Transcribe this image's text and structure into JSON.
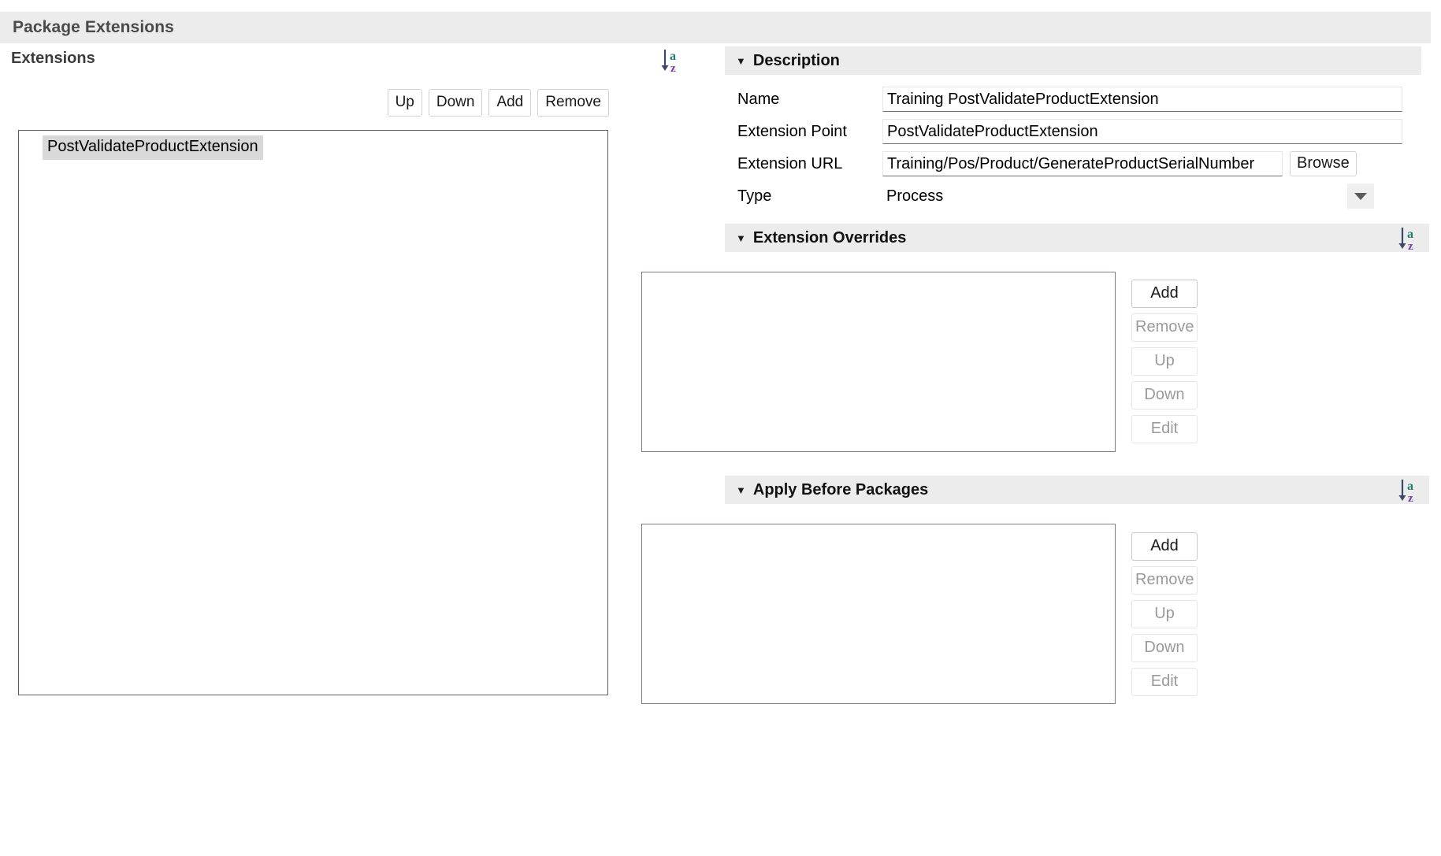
{
  "window": {
    "title": "Package Extensions"
  },
  "left_panel": {
    "heading": "Extensions",
    "sort_icon_name": "sort-a-z-icon",
    "buttons": [
      {
        "label": "Up",
        "enabled": true
      },
      {
        "label": "Down",
        "enabled": true
      },
      {
        "label": "Add",
        "enabled": true
      },
      {
        "label": "Remove",
        "enabled": true
      }
    ],
    "list_items": [
      {
        "label": "PostValidateProductExtension",
        "selected": true
      }
    ]
  },
  "description": {
    "title": "Description",
    "twisty": "▼",
    "fields": {
      "name_label": "Name",
      "name_value": "Training PostValidateProductExtension",
      "extension_point_label": "Extension Point",
      "extension_point_value": "PostValidateProductExtension",
      "extension_url_label": "Extension URL",
      "extension_url_value": "Training/Pos/Product/GenerateProductSerialNumber",
      "browse_label": "Browse",
      "type_label": "Type",
      "type_value": "Process"
    }
  },
  "extension_overrides": {
    "title": "Extension Overrides",
    "twisty": "▼",
    "sort_icon_name": "sort-a-z-icon",
    "items": [],
    "buttons": [
      {
        "label": "Add",
        "enabled": true
      },
      {
        "label": "Remove",
        "enabled": false
      },
      {
        "label": "Up",
        "enabled": false
      },
      {
        "label": "Down",
        "enabled": false
      },
      {
        "label": "Edit",
        "enabled": false
      }
    ]
  },
  "apply_before_packages": {
    "title": "Apply Before Packages",
    "twisty": "▼",
    "sort_icon_name": "sort-a-z-icon",
    "items": [],
    "buttons": [
      {
        "label": "Add",
        "enabled": true
      },
      {
        "label": "Remove",
        "enabled": false
      },
      {
        "label": "Up",
        "enabled": false
      },
      {
        "label": "Down",
        "enabled": false
      },
      {
        "label": "Edit",
        "enabled": false
      }
    ]
  },
  "colors": {
    "header_bar": "#ececec",
    "title_text": "#4a4a4a",
    "selection": "#d9d9d9",
    "sort_a": "#1f7a6f",
    "sort_z": "#7b3f9e",
    "sort_arrow": "#3b4a66"
  }
}
